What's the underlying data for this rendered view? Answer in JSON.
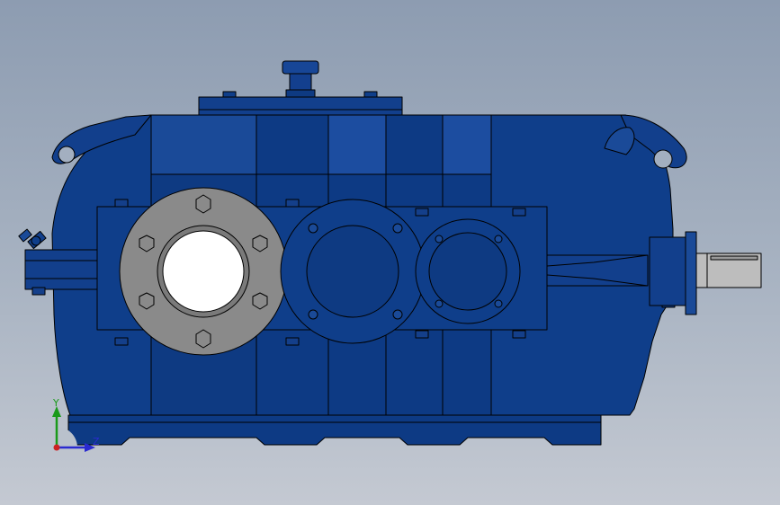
{
  "viewport": {
    "background_top": "#8d9cb1",
    "background_bottom": "#c4c9d2"
  },
  "model": {
    "body_color": "#0f3e8a",
    "body_dark": "#082a66",
    "panel_light": "#1b4c9c",
    "flange_color": "#8a8a8a",
    "shaft_color": "#bdbdbd",
    "edge_color": "#000000"
  },
  "triad": {
    "y_label": "Y",
    "z_label": "Z",
    "y_color": "#1a9a1a",
    "z_color": "#2a2ad0",
    "origin_color": "#cc2222"
  }
}
